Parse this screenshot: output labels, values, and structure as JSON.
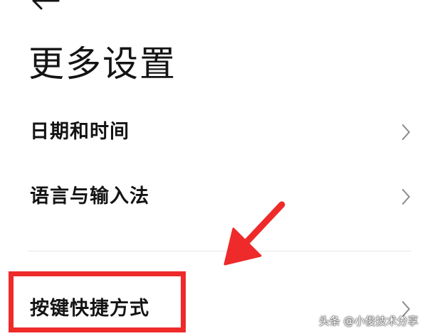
{
  "header": {
    "back_icon": "arrow-left-icon",
    "title": "更多设置"
  },
  "settings": {
    "items": [
      {
        "label": "日期和时间",
        "icon": "chevron-right-icon"
      },
      {
        "label": "语言与输入法",
        "icon": "chevron-right-icon"
      },
      {
        "label": "按键快捷方式",
        "icon": "chevron-right-icon"
      }
    ]
  },
  "annotation": {
    "highlight_color": "#ee2a2a",
    "arrow_color": "#ee2a2a"
  },
  "watermark": {
    "text": "头条 @小俊技术分享"
  }
}
